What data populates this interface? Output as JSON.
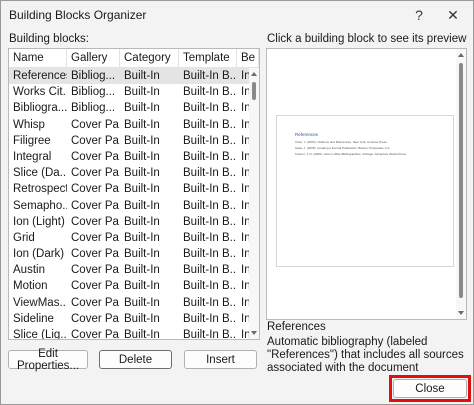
{
  "window": {
    "title": "Building Blocks Organizer",
    "help_glyph": "?",
    "close_glyph": "✕"
  },
  "left": {
    "list_label": "Building blocks:",
    "list_label_access": "B",
    "columns": [
      "Name",
      "Gallery",
      "Category",
      "Template",
      "Be"
    ],
    "rows": [
      [
        "References",
        "Bibliog...",
        "Built-In",
        "Built-In B...",
        "In"
      ],
      [
        "Works Cit...",
        "Bibliog...",
        "Built-In",
        "Built-In B...",
        "In"
      ],
      [
        "Bibliogra...",
        "Bibliog...",
        "Built-In",
        "Built-In B...",
        "In"
      ],
      [
        "Whisp",
        "Cover Pa...",
        "Built-In",
        "Built-In B...",
        "In"
      ],
      [
        "Filigree",
        "Cover Pa...",
        "Built-In",
        "Built-In B...",
        "In"
      ],
      [
        "Integral",
        "Cover Pa...",
        "Built-In",
        "Built-In B...",
        "In"
      ],
      [
        "Slice (Da...",
        "Cover Pa...",
        "Built-In",
        "Built-In B...",
        "In"
      ],
      [
        "Retrospect",
        "Cover Pa...",
        "Built-In",
        "Built-In B...",
        "In"
      ],
      [
        "Semapho...",
        "Cover Pa...",
        "Built-In",
        "Built-In B...",
        "In"
      ],
      [
        "Ion (Light)",
        "Cover Pa...",
        "Built-In",
        "Built-In B...",
        "In"
      ],
      [
        "Grid",
        "Cover Pa...",
        "Built-In",
        "Built-In B...",
        "In"
      ],
      [
        "Ion (Dark)",
        "Cover Pa...",
        "Built-In",
        "Built-In B...",
        "In"
      ],
      [
        "Austin",
        "Cover Pa...",
        "Built-In",
        "Built-In B...",
        "In"
      ],
      [
        "Motion",
        "Cover Pa...",
        "Built-In",
        "Built-In B...",
        "In"
      ],
      [
        "ViewMas...",
        "Cover Pa...",
        "Built-In",
        "Built-In B...",
        "In"
      ],
      [
        "Sideline",
        "Cover Pa...",
        "Built-In",
        "Built-In B...",
        "In"
      ],
      [
        "Slice (Lig...",
        "Cover Pa...",
        "Built-In",
        "Built-In B...",
        "In"
      ]
    ],
    "selected_index": 0
  },
  "right": {
    "preview_label": "Click a building block to see its preview",
    "preview_page": {
      "heading": "References",
      "lines": [
        "Chen, J. (2003). Citations and References. New York: Contoso Press.",
        "Haas, J. (2005). Creating a Formal Publication. Boston: Proseware, Inc.",
        "Kramer, J. D. (2006). How to Write Bibliographies. Chicago: Adventure Works Press."
      ]
    },
    "block_name": "References",
    "block_description": "Automatic bibliography (labeled \"References\") that includes all sources associated with the document"
  },
  "buttons": {
    "edit_properties": "Edit Properties...",
    "delete": "Delete",
    "insert": "Insert",
    "close": "Close"
  },
  "colors": {
    "highlight": "#e01010",
    "selection": "#e4e4e4",
    "preview_heading": "#2b5797"
  }
}
